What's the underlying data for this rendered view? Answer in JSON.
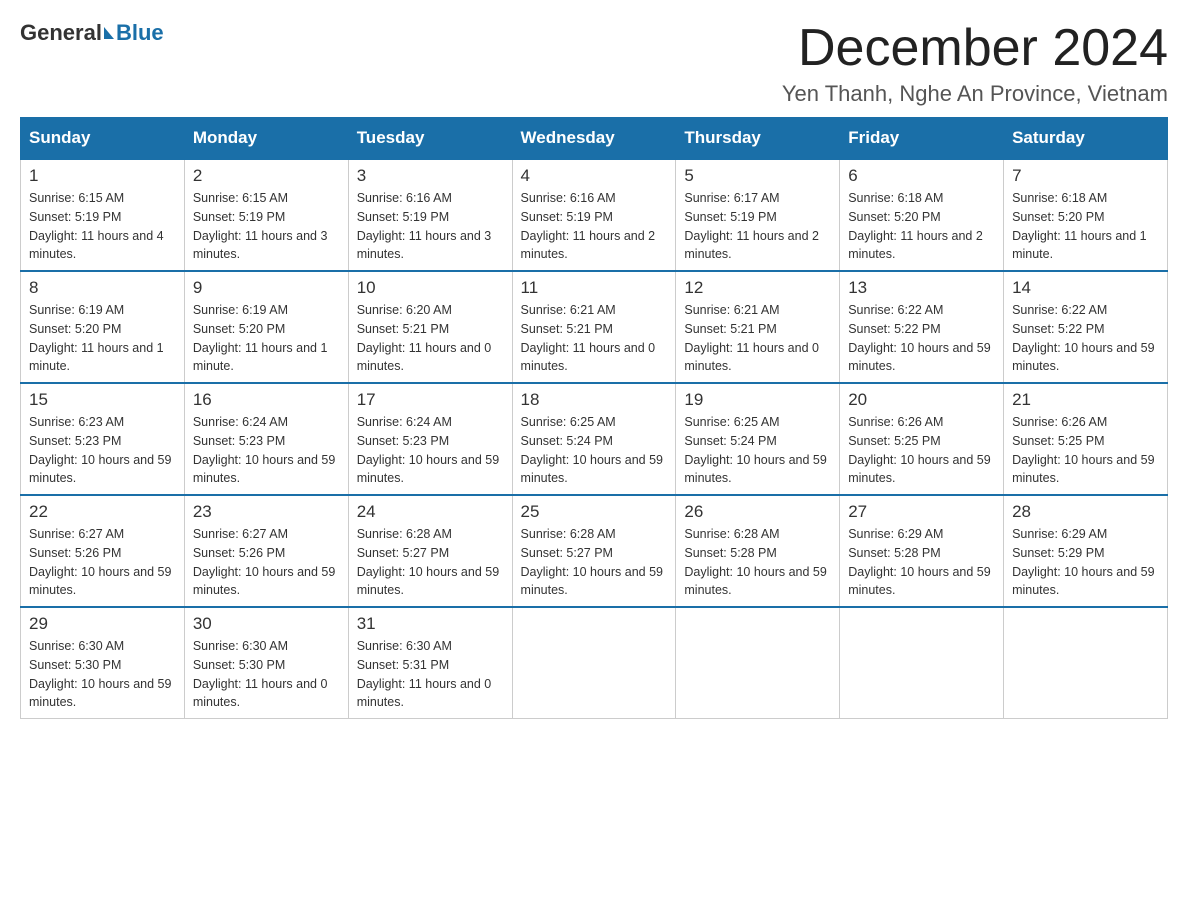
{
  "logo": {
    "general": "General",
    "blue": "Blue"
  },
  "header": {
    "month_title": "December 2024",
    "location": "Yen Thanh, Nghe An Province, Vietnam"
  },
  "weekdays": [
    "Sunday",
    "Monday",
    "Tuesday",
    "Wednesday",
    "Thursday",
    "Friday",
    "Saturday"
  ],
  "weeks": [
    [
      {
        "day": "1",
        "sunrise": "6:15 AM",
        "sunset": "5:19 PM",
        "daylight": "11 hours and 4 minutes."
      },
      {
        "day": "2",
        "sunrise": "6:15 AM",
        "sunset": "5:19 PM",
        "daylight": "11 hours and 3 minutes."
      },
      {
        "day": "3",
        "sunrise": "6:16 AM",
        "sunset": "5:19 PM",
        "daylight": "11 hours and 3 minutes."
      },
      {
        "day": "4",
        "sunrise": "6:16 AM",
        "sunset": "5:19 PM",
        "daylight": "11 hours and 2 minutes."
      },
      {
        "day": "5",
        "sunrise": "6:17 AM",
        "sunset": "5:19 PM",
        "daylight": "11 hours and 2 minutes."
      },
      {
        "day": "6",
        "sunrise": "6:18 AM",
        "sunset": "5:20 PM",
        "daylight": "11 hours and 2 minutes."
      },
      {
        "day": "7",
        "sunrise": "6:18 AM",
        "sunset": "5:20 PM",
        "daylight": "11 hours and 1 minute."
      }
    ],
    [
      {
        "day": "8",
        "sunrise": "6:19 AM",
        "sunset": "5:20 PM",
        "daylight": "11 hours and 1 minute."
      },
      {
        "day": "9",
        "sunrise": "6:19 AM",
        "sunset": "5:20 PM",
        "daylight": "11 hours and 1 minute."
      },
      {
        "day": "10",
        "sunrise": "6:20 AM",
        "sunset": "5:21 PM",
        "daylight": "11 hours and 0 minutes."
      },
      {
        "day": "11",
        "sunrise": "6:21 AM",
        "sunset": "5:21 PM",
        "daylight": "11 hours and 0 minutes."
      },
      {
        "day": "12",
        "sunrise": "6:21 AM",
        "sunset": "5:21 PM",
        "daylight": "11 hours and 0 minutes."
      },
      {
        "day": "13",
        "sunrise": "6:22 AM",
        "sunset": "5:22 PM",
        "daylight": "10 hours and 59 minutes."
      },
      {
        "day": "14",
        "sunrise": "6:22 AM",
        "sunset": "5:22 PM",
        "daylight": "10 hours and 59 minutes."
      }
    ],
    [
      {
        "day": "15",
        "sunrise": "6:23 AM",
        "sunset": "5:23 PM",
        "daylight": "10 hours and 59 minutes."
      },
      {
        "day": "16",
        "sunrise": "6:24 AM",
        "sunset": "5:23 PM",
        "daylight": "10 hours and 59 minutes."
      },
      {
        "day": "17",
        "sunrise": "6:24 AM",
        "sunset": "5:23 PM",
        "daylight": "10 hours and 59 minutes."
      },
      {
        "day": "18",
        "sunrise": "6:25 AM",
        "sunset": "5:24 PM",
        "daylight": "10 hours and 59 minutes."
      },
      {
        "day": "19",
        "sunrise": "6:25 AM",
        "sunset": "5:24 PM",
        "daylight": "10 hours and 59 minutes."
      },
      {
        "day": "20",
        "sunrise": "6:26 AM",
        "sunset": "5:25 PM",
        "daylight": "10 hours and 59 minutes."
      },
      {
        "day": "21",
        "sunrise": "6:26 AM",
        "sunset": "5:25 PM",
        "daylight": "10 hours and 59 minutes."
      }
    ],
    [
      {
        "day": "22",
        "sunrise": "6:27 AM",
        "sunset": "5:26 PM",
        "daylight": "10 hours and 59 minutes."
      },
      {
        "day": "23",
        "sunrise": "6:27 AM",
        "sunset": "5:26 PM",
        "daylight": "10 hours and 59 minutes."
      },
      {
        "day": "24",
        "sunrise": "6:28 AM",
        "sunset": "5:27 PM",
        "daylight": "10 hours and 59 minutes."
      },
      {
        "day": "25",
        "sunrise": "6:28 AM",
        "sunset": "5:27 PM",
        "daylight": "10 hours and 59 minutes."
      },
      {
        "day": "26",
        "sunrise": "6:28 AM",
        "sunset": "5:28 PM",
        "daylight": "10 hours and 59 minutes."
      },
      {
        "day": "27",
        "sunrise": "6:29 AM",
        "sunset": "5:28 PM",
        "daylight": "10 hours and 59 minutes."
      },
      {
        "day": "28",
        "sunrise": "6:29 AM",
        "sunset": "5:29 PM",
        "daylight": "10 hours and 59 minutes."
      }
    ],
    [
      {
        "day": "29",
        "sunrise": "6:30 AM",
        "sunset": "5:30 PM",
        "daylight": "10 hours and 59 minutes."
      },
      {
        "day": "30",
        "sunrise": "6:30 AM",
        "sunset": "5:30 PM",
        "daylight": "11 hours and 0 minutes."
      },
      {
        "day": "31",
        "sunrise": "6:30 AM",
        "sunset": "5:31 PM",
        "daylight": "11 hours and 0 minutes."
      },
      null,
      null,
      null,
      null
    ]
  ],
  "labels": {
    "sunrise": "Sunrise:",
    "sunset": "Sunset:",
    "daylight": "Daylight:"
  }
}
